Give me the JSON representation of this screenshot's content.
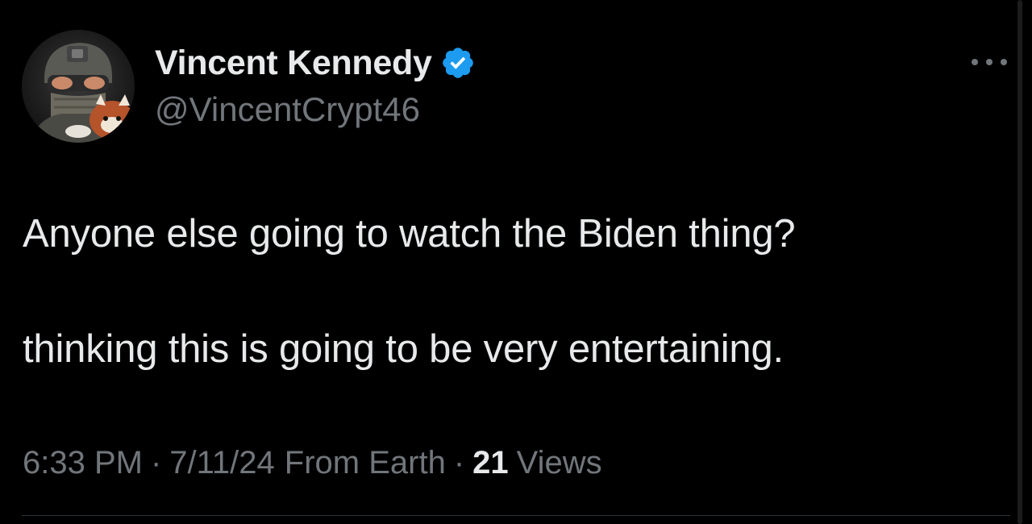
{
  "tweet": {
    "display_name": "Vincent Kennedy",
    "handle": "@VincentCrypt46",
    "verified": true,
    "verified_icon": "verified-badge-icon",
    "more_icon": "more-options-icon",
    "text_lines": [
      "Anyone else going to watch the Biden thing?",
      "thinking this is going to be very entertaining."
    ],
    "time": "6:33 PM",
    "date": "7/11/24",
    "source": "From Earth",
    "separator": "·",
    "views_count": "21",
    "views_label": "Views"
  },
  "colors": {
    "background": "#000000",
    "primary_text": "#e7e9ea",
    "secondary_text": "#71767b",
    "verified_blue": "#1d9bf0",
    "divider": "#2f3336"
  }
}
